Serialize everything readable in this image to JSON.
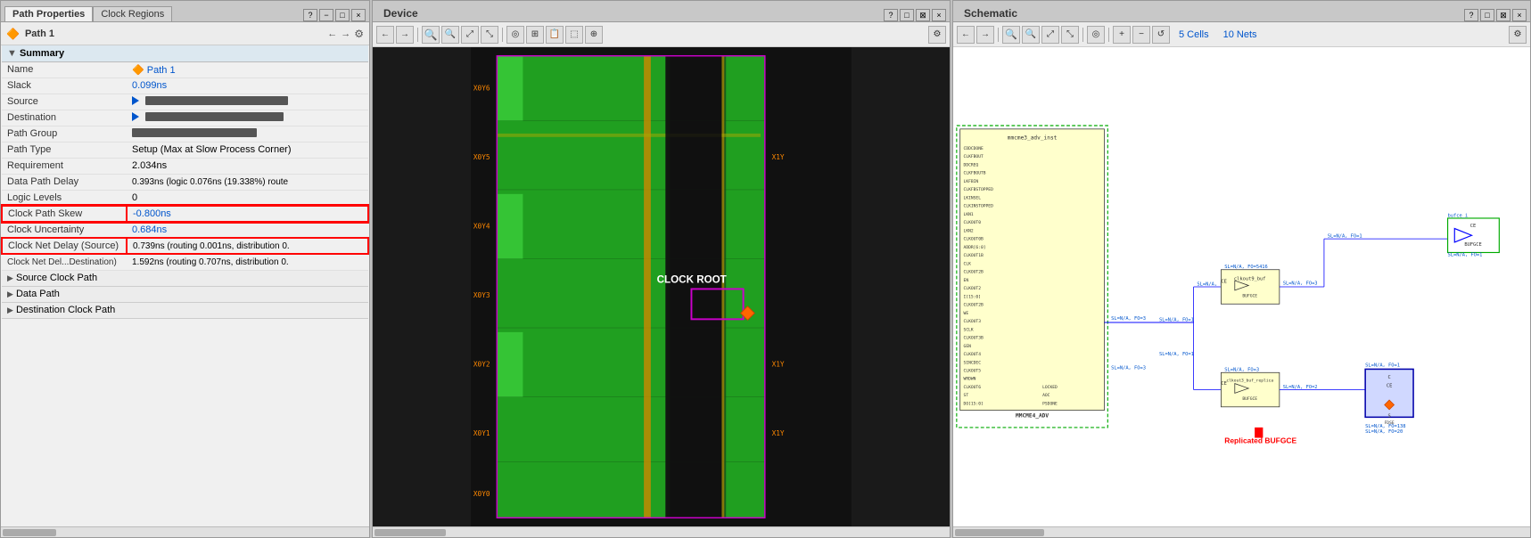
{
  "left_panel": {
    "tabs": [
      {
        "label": "Path Properties",
        "active": true
      },
      {
        "label": "Clock Regions",
        "active": false
      }
    ],
    "path_title": "Path 1",
    "toolbar": {
      "back_label": "←",
      "forward_label": "→",
      "settings_label": "⚙"
    },
    "summary_label": "Summary",
    "properties": [
      {
        "label": "Name",
        "value": "Path 1",
        "type": "name",
        "icon": true
      },
      {
        "label": "Slack",
        "value": "0.099ns",
        "type": "link"
      },
      {
        "label": "Source",
        "value": "",
        "type": "redacted"
      },
      {
        "label": "Destination",
        "value": "",
        "type": "redacted"
      },
      {
        "label": "Path Group",
        "value": "",
        "type": "redacted"
      },
      {
        "label": "Path Type",
        "value": "Setup (Max at Slow Process Corner)",
        "type": "text"
      },
      {
        "label": "Requirement",
        "value": "2.034ns",
        "type": "text"
      },
      {
        "label": "Data Path Delay",
        "value": "0.393ns (logic 0.076ns (19.338%)  route",
        "type": "text"
      },
      {
        "label": "Logic Levels",
        "value": "0",
        "type": "text"
      },
      {
        "label": "Clock Path Skew",
        "value": "-0.800ns",
        "type": "link",
        "highlight": true
      },
      {
        "label": "Clock Uncertainty",
        "value": "0.684ns",
        "type": "link"
      },
      {
        "label": "Clock Net Delay (Source)",
        "value": "0.739ns (routing 0.001ns, distribution 0.",
        "type": "link",
        "highlight": true
      },
      {
        "label": "Clock Net Del...Destination)",
        "value": "1.592ns (routing 0.707ns, distribution 0.",
        "type": "text"
      }
    ],
    "sections": [
      {
        "label": "Source Clock Path",
        "collapsed": true
      },
      {
        "label": "Data Path",
        "collapsed": true
      },
      {
        "label": "Destination Clock Path",
        "collapsed": true
      }
    ]
  },
  "middle_panel": {
    "title": "Device",
    "toolbar_buttons": [
      "←",
      "→",
      "🔍+",
      "🔍-",
      "⤢",
      "⤡",
      "◎",
      "⊞",
      "📋",
      "⬚",
      "⊕"
    ],
    "clock_root_label": "CLOCK ROOT",
    "region_labels": [
      "X0Y6",
      "X0Y5",
      "X0Y4",
      "X0Y3",
      "X0Y2",
      "X0Y1",
      "X0Y0"
    ],
    "region_labels_right": [
      "X1Y",
      "X1Y",
      "X1Y"
    ]
  },
  "right_panel": {
    "title": "Schematic",
    "cells_label": "5 Cells",
    "nets_label": "10 Nets",
    "toolbar_buttons": [
      "←",
      "→",
      "🔍+",
      "🔍-",
      "⤢",
      "⤡",
      "◎",
      "+",
      "−",
      "↺"
    ],
    "mmcme_block": {
      "title": "mmcme3_adv_inst",
      "inputs": [
        "CDDCDONE",
        "CLKFBOUT",
        "DDCREQ",
        "CLKFBOUTB",
        "LKFBIN",
        "CLKFBSTOPPED",
        "LKINSEL",
        "CLKINSTOPPED",
        "LKN1",
        "CLKOUT0",
        "LKN2",
        "CLKOUT0B",
        "ADDR[6:0]",
        "CLKOUT1B",
        "CLK",
        "CLKOUT2B",
        "EN",
        "CLKOUT2",
        "I[15:0]",
        "CLKOUT2B",
        "WE",
        "CLKOUT3",
        "SCLK",
        "CLKOUT3B",
        "GEN",
        "CLKOUT4",
        "SINCDEC",
        "CLKOUT5",
        "WRDWN",
        "CLKOUT6",
        "ST",
        "DO[15:0]",
        "LOCKED",
        "AOC",
        "PSDONE"
      ],
      "footer": "MMCME4_ADV"
    },
    "bufgce_label": "BUFGCE",
    "clkout9_buf_label": "clkout9_buf",
    "clkout9_buf_id": "SL=N/A, FO=5416",
    "bufce_i_label": "bufce_i",
    "replicated_label": "Replicated BUFGCE",
    "clkout3_buf_replica_label": "clkout3_buf_replica",
    "fdse_label": "FDSE",
    "sl_na_fo1": "SL=N/A, FO=1",
    "sl_na_fo3": "SL=N/A, FO=3",
    "sl_na_fo2": "SL=N/A, FO=2",
    "sl_na_fo13": "SL=N/A, FO=138"
  },
  "icons": {
    "close": "×",
    "minimize": "−",
    "maximize": "□",
    "restore": "❐",
    "help": "?",
    "gear": "⚙",
    "back": "←",
    "forward": "→",
    "zoom_in": "+",
    "zoom_out": "−",
    "fit": "⤢",
    "triangle_right": "▶",
    "triangle_down": "▼",
    "chevron_right": "›",
    "warning": "⚠"
  }
}
